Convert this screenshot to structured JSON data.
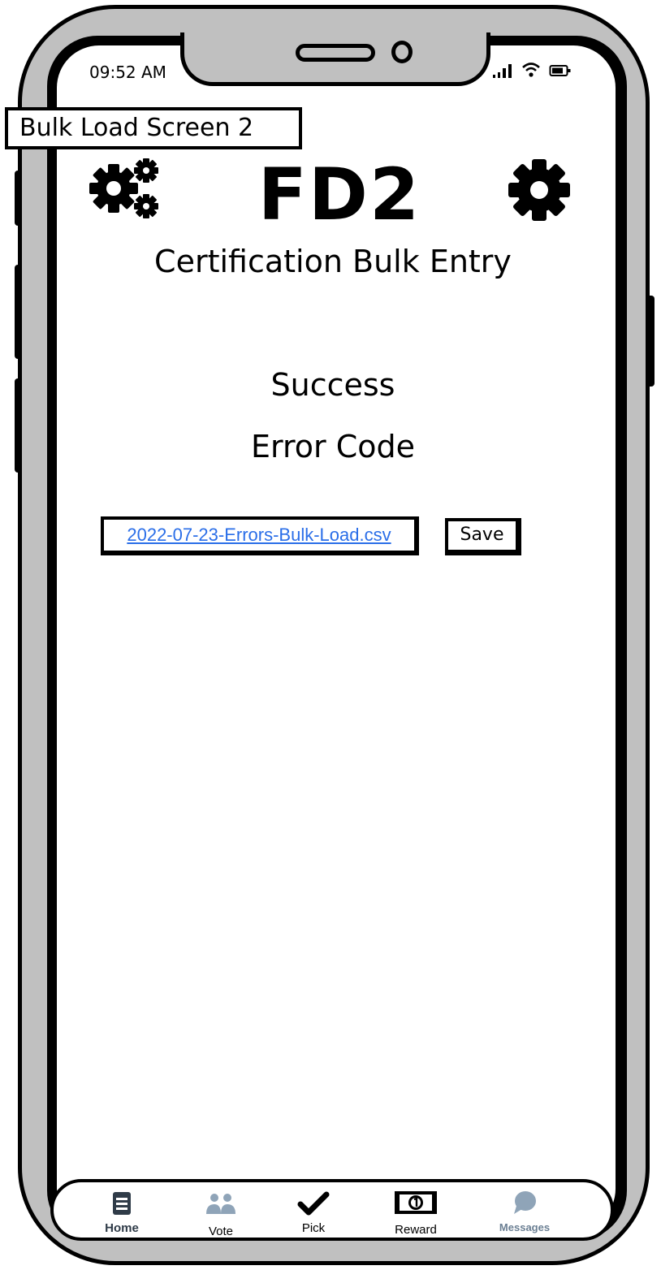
{
  "status_bar": {
    "time": "09:52 AM",
    "icons": [
      "signal-icon",
      "wifi-icon",
      "battery-icon"
    ]
  },
  "screen_label": "Bulk Load Screen 2",
  "header": {
    "title": "FD2",
    "left_icon": "gears-icon",
    "right_icon": "gear-icon",
    "subtitle": "Certification Bulk Entry"
  },
  "result": {
    "status": "Success",
    "error_code_label": "Error Code"
  },
  "file": {
    "name": "2022-07-23-Errors-Bulk-Load.csv",
    "save_label": "Save"
  },
  "bottom_nav": {
    "items": [
      {
        "label": "Home",
        "icon": "home-icon"
      },
      {
        "label": "Vote",
        "icon": "people-icon"
      },
      {
        "label": "Pick",
        "icon": "checkmark-icon"
      },
      {
        "label": "Reward",
        "icon": "banknote-icon"
      },
      {
        "label": "Messages",
        "icon": "chat-bubble-icon"
      }
    ]
  },
  "colors": {
    "phone_frame": "#c0c0c0",
    "link": "#2a6ee8",
    "nav_icon_dark": "#2f3b48",
    "nav_icon_muted": "#8fa4b8"
  }
}
